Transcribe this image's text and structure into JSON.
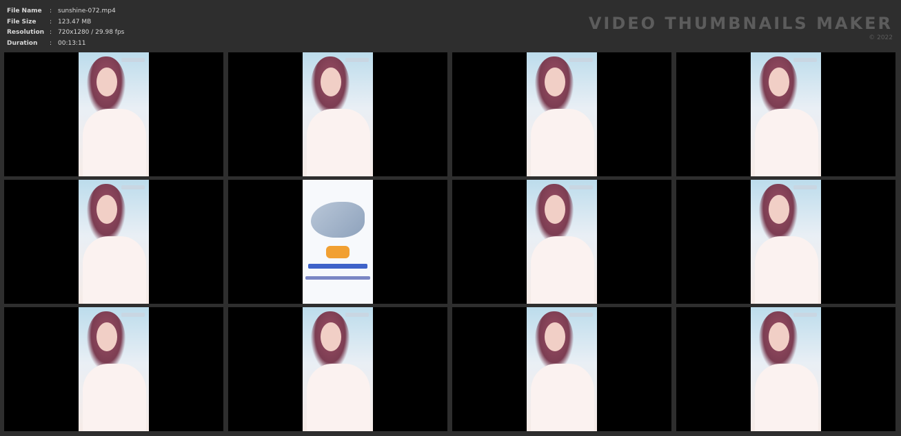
{
  "info": [
    {
      "label": "File Name",
      "value": "sunshine-072.mp4"
    },
    {
      "label": "File Size",
      "value": "123.47 MB"
    },
    {
      "label": "Resolution",
      "value": "720x1280 / 29.98 fps"
    },
    {
      "label": "Duration",
      "value": "00:13:11"
    }
  ],
  "brand": {
    "title": "VIDEO THUMBNAILS MAKER",
    "url": "© 2022"
  },
  "thumbnails": [
    "portrait",
    "portrait",
    "portrait",
    "portrait",
    "portrait",
    "promo",
    "portrait",
    "portrait",
    "portrait",
    "portrait",
    "portrait",
    "portrait"
  ]
}
